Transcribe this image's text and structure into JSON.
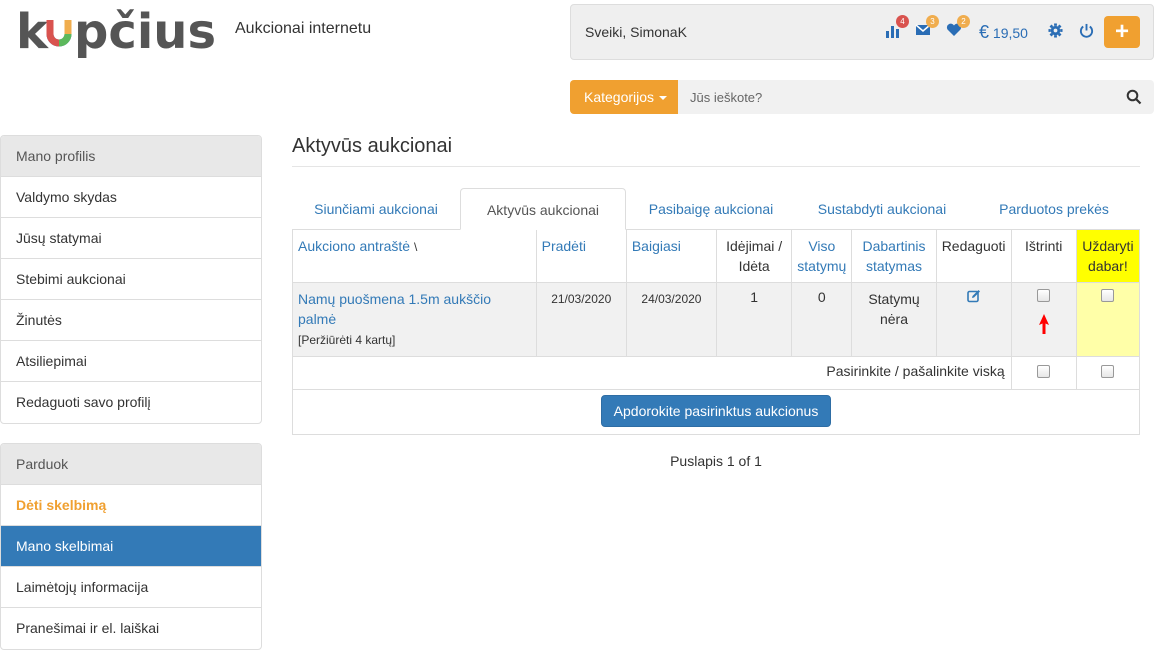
{
  "header": {
    "logo_text": "kupčius",
    "tagline": "Aukcionai internetu"
  },
  "userbar": {
    "greeting": "Sveiki, SimonaK",
    "stats_badge": "4",
    "mail_badge": "3",
    "fav_badge": "2",
    "currency": "€",
    "balance": "19,50",
    "plus": "+"
  },
  "search": {
    "category_label": "Kategorijos",
    "placeholder": "Jūs ieškote?"
  },
  "sidebar": {
    "profile": {
      "title": "Mano profilis",
      "items": [
        "Valdymo skydas",
        "Jūsų statymai",
        "Stebimi aukcionai",
        "Žinutės",
        "Atsiliepimai",
        "Redaguoti savo profilį"
      ]
    },
    "sell": {
      "title": "Parduok",
      "items": [
        "Dėti skelbimą",
        "Mano skelbimai",
        "Laimėtojų informacija",
        "Pranešimai ir el. laiškai"
      ]
    }
  },
  "main": {
    "title": "Aktyvūs aukcionai",
    "tabs": [
      "Siunčiami aukcionai",
      "Aktyvūs aukcionai",
      "Pasibaigę aukcionai",
      "Sustabdyti aukcionai",
      "Parduotos prekės"
    ],
    "columns": {
      "title": "Aukciono antraštė",
      "sort_mark": "\\",
      "started": "Pradėti",
      "ends": "Baigiasi",
      "posted_1": "Idėjimai /",
      "posted_2": "Idėta",
      "bids_1": "Viso",
      "bids_2": "statymų",
      "current_1": "Dabartinis",
      "current_2": "statymas",
      "edit": "Redaguoti",
      "delete": "Ištrinti",
      "close_1": "Uždaryti",
      "close_2": "dabar!"
    },
    "rows": [
      {
        "title": "Namų puošmena 1.5m aukščio palmė",
        "views": "[Peržiūrėti 4 kartų]",
        "started": "21/03/2020",
        "ends": "24/03/2020",
        "posted": "1",
        "bids": "0",
        "current_1": "Statymų",
        "current_2": "nėra"
      }
    ],
    "select_all": "Pasirinkite / pašalinkite viską",
    "process_button": "Apdorokite pasirinktus aukcionus",
    "pager": "Puslapis 1 of 1"
  },
  "colors": {
    "accent_orange": "#f0a030",
    "link_blue": "#337ab7",
    "highlight_yellow": "#ffff00",
    "annotation_red": "#ff0000"
  }
}
